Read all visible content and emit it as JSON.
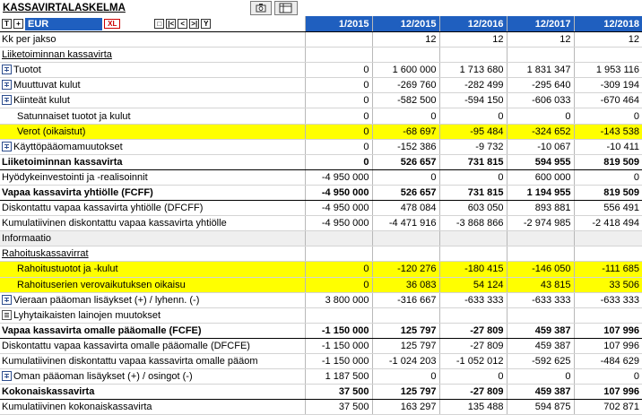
{
  "title": "KASSAVIRTALASKELMA",
  "toolbar": {
    "camera_icon": "camera-icon",
    "sheet_icon": "sheet-icon"
  },
  "header": {
    "currency": "EUR",
    "nav": {
      "first": "|<",
      "prev": "<",
      "next": ">|",
      "filter": "Y"
    },
    "columns": [
      "1/2015",
      "12/2015",
      "12/2016",
      "12/2017",
      "12/2018"
    ]
  },
  "rows": [
    {
      "label": "Kk per jakso",
      "values": [
        "",
        "12",
        "12",
        "12",
        "12"
      ]
    },
    {
      "label": "Liiketoiminnan kassavirta",
      "values": [
        "",
        "",
        "",
        "",
        ""
      ]
    },
    {
      "label": "Tuotot",
      "values": [
        "0",
        "1 600 000",
        "1 713 680",
        "1 831 347",
        "1 953 116"
      ]
    },
    {
      "label": "Muuttuvat kulut",
      "values": [
        "0",
        "-269 760",
        "-282 499",
        "-295 640",
        "-309 194"
      ]
    },
    {
      "label": "Kiinteät kulut",
      "values": [
        "0",
        "-582 500",
        "-594 150",
        "-606 033",
        "-670 464"
      ]
    },
    {
      "label": "Satunnaiset tuotot ja kulut",
      "values": [
        "0",
        "0",
        "0",
        "0",
        "0"
      ]
    },
    {
      "label": "Verot (oikaistut)",
      "values": [
        "0",
        "-68 697",
        "-95 484",
        "-324 652",
        "-143 538"
      ]
    },
    {
      "label": "Käyttöpääomamuutokset",
      "values": [
        "0",
        "-152 386",
        "-9 732",
        "-10 067",
        "-10 411"
      ]
    },
    {
      "label": "Liiketoiminnan kassavirta",
      "values": [
        "0",
        "526 657",
        "731 815",
        "594 955",
        "819 509"
      ]
    },
    {
      "label": "Hyödykeinvestointi ja -realisoinnit",
      "values": [
        "-4 950 000",
        "0",
        "0",
        "600 000",
        "0"
      ]
    },
    {
      "label": "Vapaa kassavirta yhtiölle (FCFF)",
      "values": [
        "-4 950 000",
        "526 657",
        "731 815",
        "1 194 955",
        "819 509"
      ]
    },
    {
      "label": "Diskontattu vapaa kassavirta yhtiölle (DFCFF)",
      "values": [
        "-4 950 000",
        "478 084",
        "603 050",
        "893 881",
        "556 491"
      ]
    },
    {
      "label": "Kumulatiivinen diskontattu vapaa kassavirta yhtiölle",
      "values": [
        "-4 950 000",
        "-4 471 916",
        "-3 868 866",
        "-2 974 985",
        "-2 418 494"
      ]
    },
    {
      "label": "Informaatio",
      "values": [
        "",
        "",
        "",
        "",
        ""
      ]
    },
    {
      "label": "Rahoituskassavirrat",
      "values": [
        "",
        "",
        "",
        "",
        ""
      ]
    },
    {
      "label": "Rahoitustuotot ja -kulut",
      "values": [
        "0",
        "-120 276",
        "-180 415",
        "-146 050",
        "-111 685"
      ]
    },
    {
      "label": "Rahoituserien verovaikutuksen oikaisu",
      "values": [
        "0",
        "36 083",
        "54 124",
        "43 815",
        "33 506"
      ]
    },
    {
      "label": "Vieraan pääoman lisäykset (+) / lyhenn. (-)",
      "values": [
        "3 800 000",
        "-316 667",
        "-633 333",
        "-633 333",
        "-633 333"
      ]
    },
    {
      "label": "Lyhytaikaisten lainojen muutokset",
      "values": [
        "",
        "",
        "",
        "",
        ""
      ]
    },
    {
      "label": "Vapaa kassavirta omalle pääomalle (FCFE)",
      "values": [
        "-1 150 000",
        "125 797",
        "-27 809",
        "459 387",
        "107 996"
      ]
    },
    {
      "label": "Diskontattu vapaa kassavirta omalle pääomalle (DFCFE)",
      "values": [
        "-1 150 000",
        "125 797",
        "-27 809",
        "459 387",
        "107 996"
      ]
    },
    {
      "label": "Kumulatiivinen diskontattu vapaa kassavirta omalle pääom",
      "values": [
        "-1 150 000",
        "-1 024 203",
        "-1 052 012",
        "-592 625",
        "-484 629"
      ]
    },
    {
      "label": "Oman pääoman lisäykset (+) / osingot (-)",
      "values": [
        "1 187 500",
        "0",
        "0",
        "0",
        "0"
      ]
    },
    {
      "label": "Kokonaiskassavirta",
      "values": [
        "37 500",
        "125 797",
        "-27 809",
        "459 387",
        "107 996"
      ]
    },
    {
      "label": "Kumulatiivinen kokonaiskassavirta",
      "values": [
        "37 500",
        "163 297",
        "135 488",
        "594 875",
        "702 871"
      ]
    }
  ],
  "colors": {
    "header_blue": "#1f5fbf",
    "highlight_yellow": "#ffff00"
  }
}
